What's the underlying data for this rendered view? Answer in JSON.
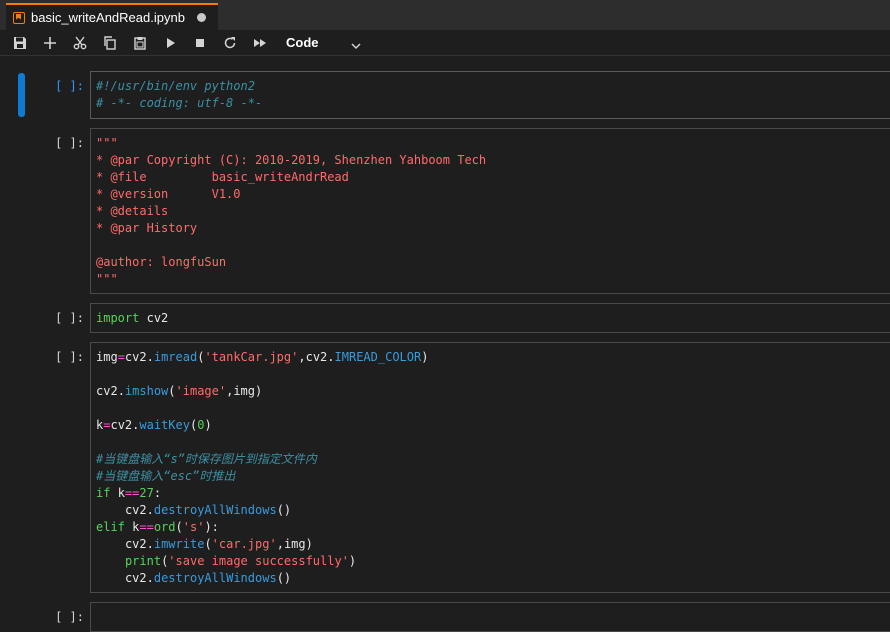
{
  "tab": {
    "title": "basic_writeAndRead.ipynb"
  },
  "toolbar": {
    "buttons": [
      "save-icon",
      "add-icon",
      "cut-icon",
      "copy-icon",
      "paste-icon",
      "run-icon",
      "stop-icon",
      "restart-icon",
      "fast-forward-icon"
    ],
    "cell_type": "Code"
  },
  "cells": [
    {
      "prompt": "[ ]:",
      "lines": [
        "#!/usr/bin/env python2",
        "# -*- coding: utf-8 -*-"
      ]
    },
    {
      "prompt": "[ ]:",
      "lines": [
        "\"\"\"",
        "* @par Copyright (C): 2010-2019, Shenzhen Yahboom Tech",
        "* @file         basic_writeAndrRead",
        "* @version      V1.0",
        "* @details",
        "* @par History",
        "",
        "@author: longfuSun",
        "\"\"\""
      ]
    },
    {
      "prompt": "[ ]:",
      "lines": [
        "import cv2"
      ]
    },
    {
      "prompt": "[ ]:",
      "lines": [
        "img=cv2.imread('tankCar.jpg',cv2.IMREAD_COLOR)",
        "",
        "cv2.imshow('image',img)",
        "",
        "k=cv2.waitKey(0)",
        "",
        "#当键盘输入“s”时保存图片到指定文件内",
        "#当键盘输入“esc”时推出",
        "if k==27:",
        "    cv2.destroyAllWindows()",
        "elif k==ord('s'):",
        "    cv2.imwrite('car.jpg',img)",
        "    print('save image successfully')",
        "    cv2.destroyAllWindows()"
      ]
    },
    {
      "prompt": "[ ]:",
      "lines": []
    }
  ],
  "colors": {
    "accent": "#0e7ad3",
    "comment": "#3c8fa3",
    "string": "#ff6b6b",
    "keyword": "#56d35a",
    "attribute": "#3a9bdc",
    "operator": "#ff4fd8"
  }
}
